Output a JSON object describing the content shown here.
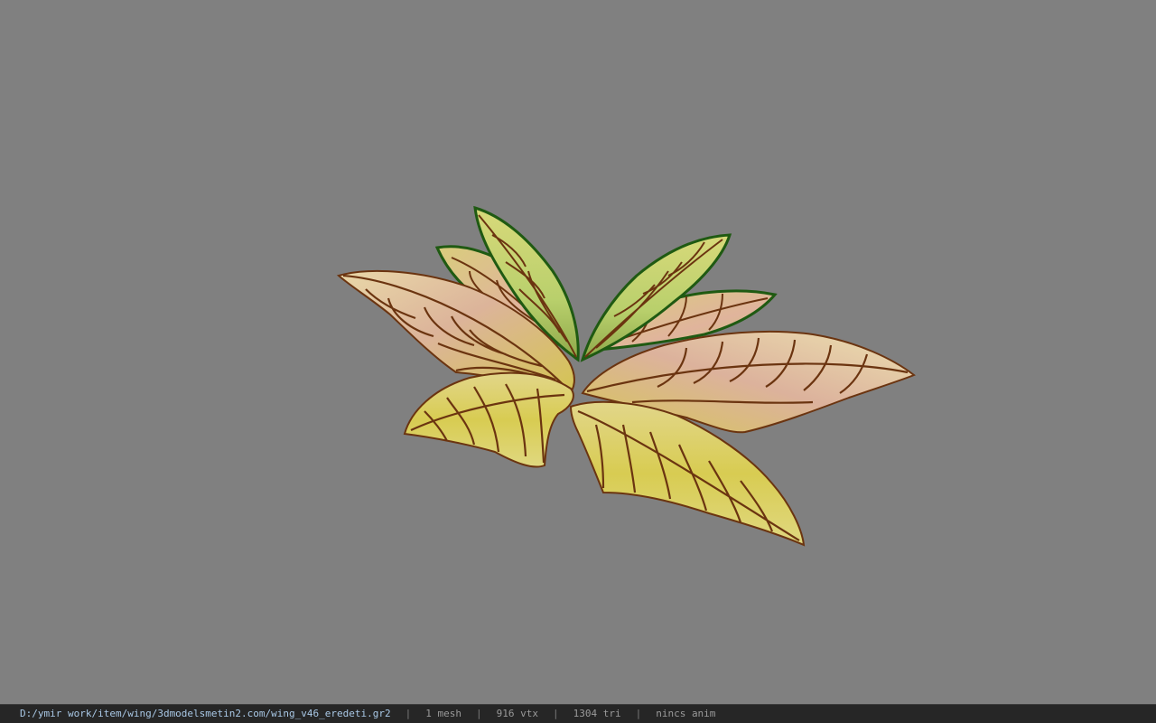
{
  "viewer": {
    "background_color": "#808080",
    "model": {
      "name": "butterfly-wing-model",
      "colors": {
        "fill_light": "#e6dd8a",
        "fill_pink": "#e0b6a0",
        "fill_green": "#b8cf6e",
        "fill_yellow": "#d9cf55",
        "vein": "#6b3410",
        "edge_green": "#1f5a12"
      }
    }
  },
  "status": {
    "file_path": "D:/ymir work/item/wing/3dmodelsmetin2.com/wing_v46_eredeti.gr2",
    "mesh_count": "1 mesh",
    "vertex_count": "916 vtx",
    "triangle_count": "1304 tri",
    "animation": "nincs anim",
    "separator": "|"
  }
}
